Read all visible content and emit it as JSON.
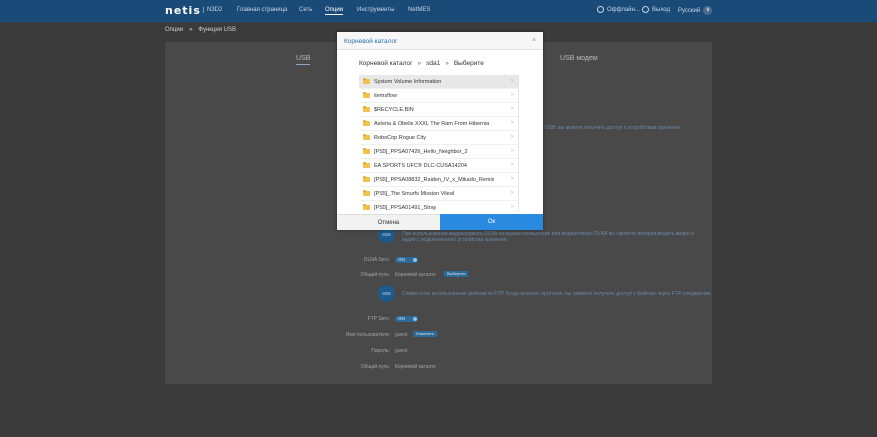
{
  "header": {
    "logo": "netis",
    "model": "N3D2",
    "nav": [
      "Главная страница",
      "Сеть",
      "Опции",
      "Инструменты",
      "NetMES"
    ],
    "active_nav": 2,
    "user": "Оффлайн...",
    "logout": "Выход",
    "lang": "Русский",
    "lang_btn": "∨"
  },
  "breadcrumb": [
    "Опции",
    "Функция USB"
  ],
  "tabs": [
    "USB",
    "USB модем"
  ],
  "background": {
    "hint1": "USB, вы можете получить доступ к устройствам хранения.",
    "dlna_text": "При использовании медиасервера DLNA на вашем компьютере или медиаплеере DLNA вы сможете воспроизводить видео и аудио с подключенного устройства хранения.",
    "dlna_label": "DLNA Serv:",
    "dlna_toggle": "ON",
    "share_label": "Общий путь:",
    "share_val": "Корневой каталог",
    "choose_btn": "Выберите",
    "ftp_text": "Совместное использование файлов по FTP. Когда включен протокол, вы сможете получить доступ к файлам через FTP-соединение.",
    "ftp_label": "FTP Serv:",
    "ftp_toggle": "ON",
    "user_label": "Имя пользователя:",
    "user_val": "guest",
    "user_btn": "Изменить",
    "pass_label": "Пароль:",
    "pass_val": "guest",
    "ftp_share_label": "Общий путь:",
    "ftp_share_val": "Корневой каталог"
  },
  "modal": {
    "title": "Корневой каталог",
    "close": "×",
    "path": [
      "Корневой каталог",
      "sda1",
      "Выберите"
    ],
    "path_sep": "»",
    "items": [
      "System Volume Information",
      "itemsflow",
      "$RECYCLE.BIN",
      "Asteria & Obelix XXXL The Ram From Hibernia",
      "RoboCop Rogue City",
      "[PS5]_PPSA07426_Hello_Neighbor_2",
      "EA SPORTS UFC® DLC-CUSA14204",
      "[PS5]_PPSA08832_Raiden_IV_x_Mikado_Remix",
      "[PS5]_The Smurfs Mission Vileaf",
      "[PS5]_PPSA01491_Stray"
    ],
    "selected_index": 0,
    "chevron": "›",
    "cancel": "Отмена",
    "ok": "Ок"
  },
  "colors": {
    "topbar": "#1a4a78",
    "accent": "#2a8ae0",
    "folder": "#f2c14e"
  }
}
